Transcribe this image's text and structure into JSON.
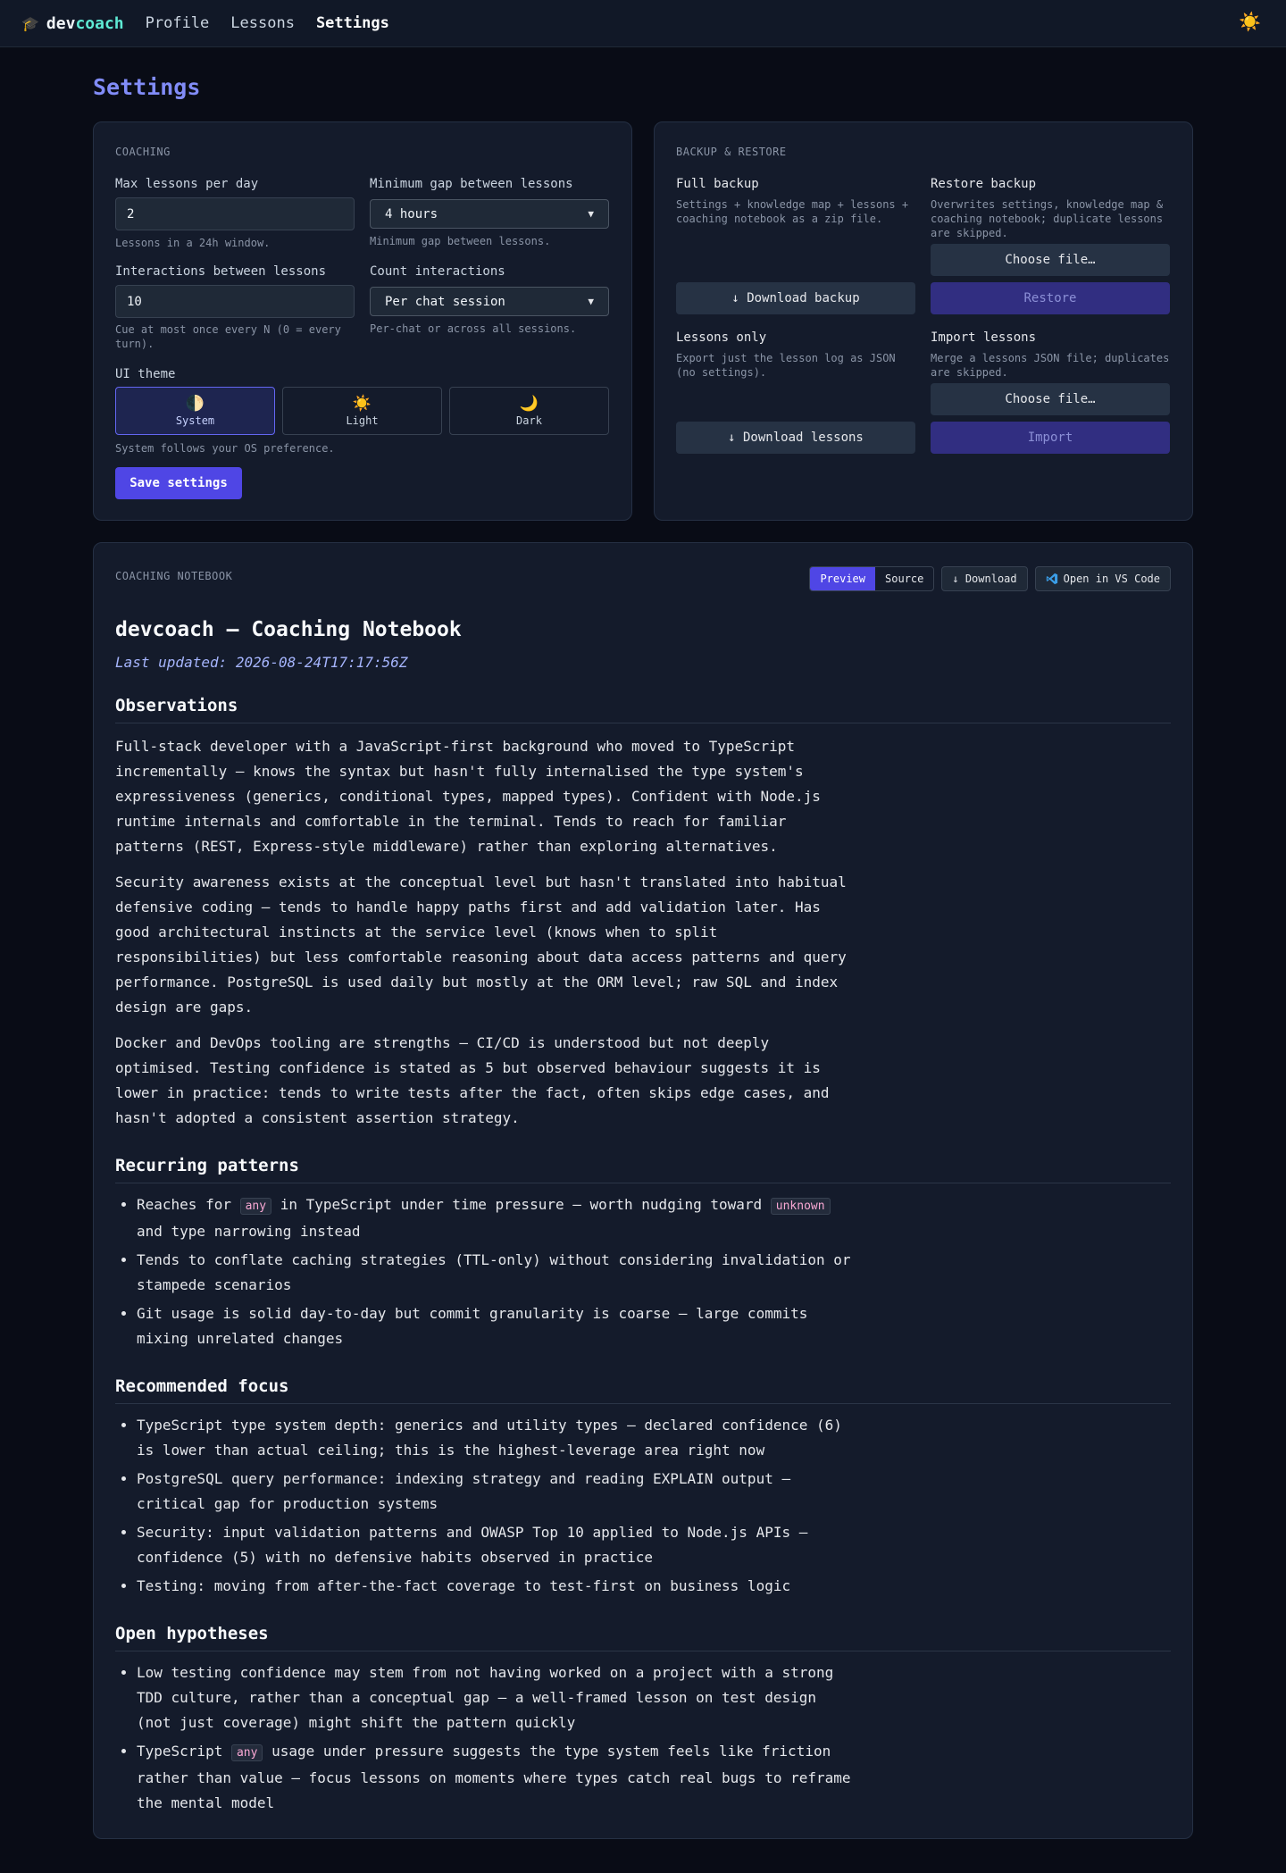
{
  "nav": {
    "brand_prefix": "dev",
    "brand_suffix": "coach",
    "links": [
      "Profile",
      "Lessons",
      "Settings"
    ],
    "active": "Settings",
    "theme_icon": "sun-icon"
  },
  "page_title": "Settings",
  "coaching": {
    "section": "COACHING",
    "max_lessons": {
      "label": "Max lessons per day",
      "value": "2",
      "hint": "Lessons in a 24h window."
    },
    "min_gap": {
      "label": "Minimum gap between lessons",
      "value": "4 hours",
      "hint": "Minimum gap between lessons."
    },
    "interactions": {
      "label": "Interactions between lessons",
      "value": "10",
      "hint": "Cue at most once every N (0 = every turn)."
    },
    "count": {
      "label": "Count interactions",
      "value": "Per chat session",
      "hint": "Per-chat or across all sessions."
    },
    "theme": {
      "label": "UI theme",
      "options": [
        {
          "icon": "half-moon-icon",
          "glyph": "🌓",
          "label": "System"
        },
        {
          "icon": "sun-icon",
          "glyph": "☀️",
          "label": "Light"
        },
        {
          "icon": "crescent-moon-icon",
          "glyph": "🌙",
          "label": "Dark"
        }
      ],
      "selected": "System",
      "hint": "System follows your OS preference."
    },
    "save_label": "Save settings"
  },
  "backup": {
    "section": "BACKUP & RESTORE",
    "full": {
      "title": "Full backup",
      "desc": "Settings + knowledge map + lessons + coaching notebook as a zip file.",
      "button": "↓ Download backup"
    },
    "restore": {
      "title": "Restore backup",
      "desc": "Overwrites settings, knowledge map & coaching notebook; duplicate lessons are skipped.",
      "choose": "Choose file…",
      "button": "Restore"
    },
    "lessons_only": {
      "title": "Lessons only",
      "desc": "Export just the lesson log as JSON (no settings).",
      "button": "↓ Download lessons"
    },
    "import": {
      "title": "Import lessons",
      "desc": "Merge a lessons JSON file; duplicates are skipped.",
      "choose": "Choose file…",
      "button": "Import"
    }
  },
  "notebook": {
    "section": "COACHING NOTEBOOK",
    "toolbar": {
      "preview": "Preview",
      "source": "Source",
      "download": "↓ Download",
      "vscode": "Open in VS Code"
    },
    "title": "devcoach — Coaching Notebook",
    "updated": "Last updated: 2026-08-24T17:17:56Z",
    "observations": {
      "heading": "Observations",
      "paragraphs": [
        "Full-stack developer with a JavaScript-first background who moved to TypeScript incrementally — knows the syntax but hasn't fully internalised the type system's expressiveness (generics, conditional types, mapped types). Confident with Node.js runtime internals and comfortable in the terminal. Tends to reach for familiar patterns (REST, Express-style middleware) rather than exploring alternatives.",
        "Security awareness exists at the conceptual level but hasn't translated into habitual defensive coding — tends to handle happy paths first and add validation later. Has good architectural instincts at the service level (knows when to split responsibilities) but less comfortable reasoning about data access patterns and query performance. PostgreSQL is used daily but mostly at the ORM level; raw SQL and index design are gaps.",
        "Docker and DevOps tooling are strengths — CI/CD is understood but not deeply optimised. Testing confidence is stated as 5 but observed behaviour suggests it is lower in practice: tends to write tests after the fact, often skips edge cases, and hasn't adopted a consistent assertion strategy."
      ]
    },
    "recurring": {
      "heading": "Recurring patterns",
      "item1": {
        "a": "Reaches for ",
        "code1": "any",
        "b": " in TypeScript under time pressure — worth nudging toward ",
        "code2": "unknown",
        "c": " and type narrowing instead"
      },
      "item2": "Tends to conflate caching strategies (TTL-only) without considering invalidation or stampede scenarios",
      "item3": "Git usage is solid day-to-day but commit granularity is coarse — large commits mixing unrelated changes"
    },
    "focus": {
      "heading": "Recommended focus",
      "items": [
        "TypeScript type system depth: generics and utility types — declared confidence (6) is lower than actual ceiling; this is the highest-leverage area right now",
        "PostgreSQL query performance: indexing strategy and reading EXPLAIN output — critical gap for production systems",
        "Security: input validation patterns and OWASP Top 10 applied to Node.js APIs — confidence (5) with no defensive habits observed in practice",
        "Testing: moving from after-the-fact coverage to test-first on business logic"
      ]
    },
    "hypotheses": {
      "heading": "Open hypotheses",
      "item1": "Low testing confidence may stem from not having worked on a project with a strong TDD culture, rather than a conceptual gap — a well-framed lesson on test design (not just coverage) might shift the pattern quickly",
      "item2": {
        "a": "TypeScript ",
        "code": "any",
        "b": " usage under pressure suggests the type system feels like friction rather than value — focus lessons on moments where types catch real bugs to reframe the mental model"
      }
    }
  }
}
